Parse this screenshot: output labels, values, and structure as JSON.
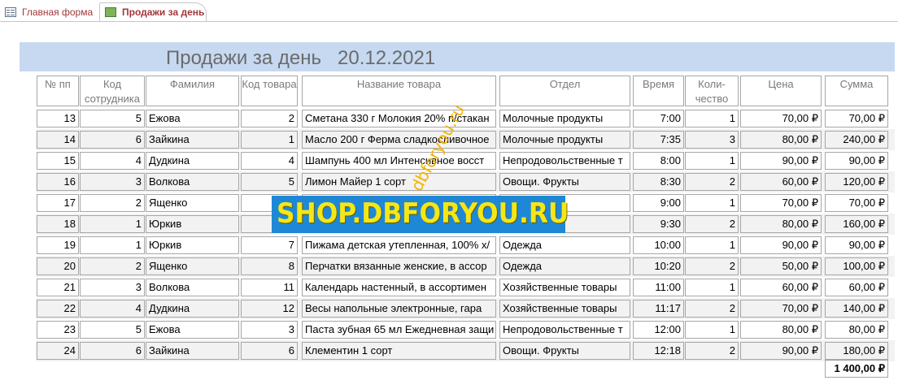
{
  "tabs": [
    {
      "label": "Главная форма",
      "icon": "form-icon",
      "active": false
    },
    {
      "label": "Продажи за день",
      "icon": "report-icon",
      "active": true
    }
  ],
  "report": {
    "title": "Продажи за день",
    "date": "20.12.2021"
  },
  "columns": [
    "№ пп",
    "Код сотрудника",
    "Фамилия",
    "Код товара",
    "Название товара",
    "Отдел",
    "Время",
    "Коли-чество",
    "Цена",
    "Сумма"
  ],
  "rows": [
    [
      "13",
      "5",
      "Ежова",
      "2",
      "Сметана 330 г Молокия 20% п/стакан",
      "Молочные продукты",
      "7:00",
      "1",
      "70,00 ₽",
      "70,00 ₽"
    ],
    [
      "14",
      "6",
      "Зайкина",
      "1",
      "Масло 200 г Ферма сладкосливочное",
      "Молочные продукты",
      "7:35",
      "3",
      "80,00 ₽",
      "240,00 ₽"
    ],
    [
      "15",
      "4",
      "Дудкина",
      "4",
      "Шампунь 400 мл  Интенсивное восст",
      "Непродовольственные т",
      "8:00",
      "1",
      "90,00 ₽",
      "90,00 ₽"
    ],
    [
      "16",
      "3",
      "Волкова",
      "5",
      "Лимон Майер 1 сорт",
      "Овощи. Фрукты",
      "8:30",
      "2",
      "60,00 ₽",
      "120,00 ₽"
    ],
    [
      "17",
      "2",
      "Ященко",
      "",
      "",
      "дукты",
      "9:00",
      "1",
      "70,00 ₽",
      "70,00 ₽"
    ],
    [
      "18",
      "1",
      "Юркив",
      "",
      "",
      "дукты",
      "9:30",
      "2",
      "80,00 ₽",
      "160,00 ₽"
    ],
    [
      "19",
      "1",
      "Юркив",
      "7",
      "Пижама детская утепленная, 100% х/",
      "Одежда",
      "10:00",
      "1",
      "90,00 ₽",
      "90,00 ₽"
    ],
    [
      "20",
      "2",
      "Ященко",
      "8",
      "Перчатки вязанные женские, в ассор",
      "Одежда",
      "10:20",
      "2",
      "50,00 ₽",
      "100,00 ₽"
    ],
    [
      "21",
      "3",
      "Волкова",
      "11",
      "Календарь настенный, в ассортимен",
      "Хозяйственные товары",
      "11:00",
      "1",
      "60,00 ₽",
      "60,00 ₽"
    ],
    [
      "22",
      "4",
      "Дудкина",
      "12",
      "Весы напольные электронные, гара",
      "Хозяйственные товары",
      "11:17",
      "2",
      "70,00 ₽",
      "140,00 ₽"
    ],
    [
      "23",
      "5",
      "Ежова",
      "3",
      "Паста зубная 65 мл Ежедневная защи",
      "Непродовольственные т",
      "12:00",
      "1",
      "80,00 ₽",
      "80,00 ₽"
    ],
    [
      "24",
      "6",
      "Зайкина",
      "6",
      "Клементин 1 сорт",
      "Овощи. Фрукты",
      "12:18",
      "2",
      "90,00 ₽",
      "180,00 ₽"
    ]
  ],
  "total": "1 400,00 ₽",
  "watermark": {
    "banner": "SHOP.DBFORYOU.RU",
    "diagonal": "dbforyou.ru"
  }
}
